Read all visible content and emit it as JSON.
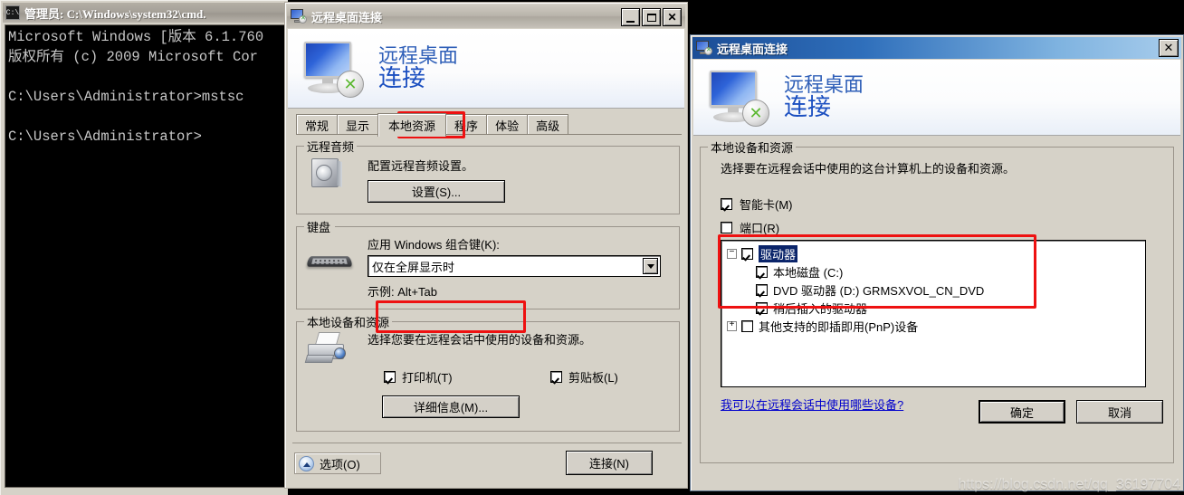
{
  "cmd_window": {
    "title": "管理员: C:\\Windows\\system32\\cmd.",
    "icon": "cmd-icon",
    "lines": [
      "Microsoft Windows [版本 6.1.760",
      "版权所有 (c) 2009 Microsoft Cor",
      "",
      "C:\\Users\\Administrator>mstsc",
      "",
      "C:\\Users\\Administrator>"
    ]
  },
  "rdp_main": {
    "title": "远程桌面连接",
    "brand_line1": "远程桌面",
    "brand_line2": "连接",
    "window_controls": {
      "minimize": "_",
      "maximize": "☐",
      "close": "✕"
    },
    "tabs": [
      {
        "label": "常规",
        "active": false
      },
      {
        "label": "显示",
        "active": false
      },
      {
        "label": "本地资源",
        "active": true
      },
      {
        "label": "程序",
        "active": false
      },
      {
        "label": "体验",
        "active": false
      },
      {
        "label": "高级",
        "active": false
      }
    ],
    "remote_audio": {
      "group_label": "远程音频",
      "description": "配置远程音频设置。",
      "settings_button": "设置(S)..."
    },
    "keyboard": {
      "group_label": "键盘",
      "description": "应用 Windows 组合键(K):",
      "combo_value": "仅在全屏显示时",
      "example": "示例: Alt+Tab"
    },
    "local_devices": {
      "group_label": "本地设备和资源",
      "description": "选择您要在远程会话中使用的设备和资源。",
      "printers": {
        "label": "打印机(T)",
        "checked": true
      },
      "clipboard": {
        "label": "剪贴板(L)",
        "checked": true
      },
      "more_button": "详细信息(M)..."
    },
    "footer": {
      "options_button": "选项(O)",
      "connect_button": "连接(N)"
    }
  },
  "rdp_details": {
    "title": "远程桌面连接",
    "brand_line1": "远程桌面",
    "brand_line2": "连接",
    "close_label": "✕",
    "group_label": "本地设备和资源",
    "description": "选择要在远程会话中使用的这台计算机上的设备和资源。",
    "smartcard": {
      "label": "智能卡(M)",
      "checked": true
    },
    "ports": {
      "label": "端口(R)",
      "checked": false
    },
    "tree": [
      {
        "label": "驱动器",
        "checked": true,
        "expander": "−",
        "indent": 0,
        "selected": true
      },
      {
        "label": "本地磁盘 (C:)",
        "checked": true,
        "expander": "",
        "indent": 1,
        "selected": false
      },
      {
        "label": "DVD 驱动器 (D:) GRMSXVOL_CN_DVD",
        "checked": true,
        "expander": "",
        "indent": 1,
        "selected": false
      },
      {
        "label": "稍后插入的驱动器",
        "checked": true,
        "expander": "",
        "indent": 1,
        "selected": false
      },
      {
        "label": "其他支持的即插即用(PnP)设备",
        "checked": false,
        "expander": "+",
        "indent": 0,
        "selected": false
      }
    ],
    "help_link": "我可以在远程会话中使用哪些设备?",
    "ok_button": "确定",
    "cancel_button": "取消"
  },
  "watermark": "https://blog.csdn.net/qq_36197704",
  "annotations": {
    "highlight_color": "#ee1111",
    "boxes": [
      "tab-local-resources",
      "more-button",
      "drives-tree-group"
    ]
  }
}
